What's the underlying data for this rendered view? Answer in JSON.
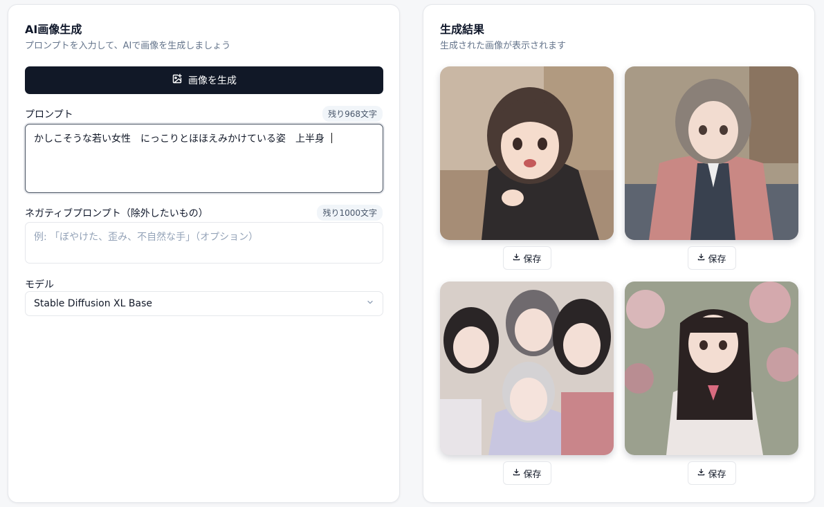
{
  "left_panel": {
    "title": "AI画像生成",
    "subtitle": "プロンプトを入力して、AIで画像を生成しましょう",
    "generate_button": {
      "label": "画像を生成",
      "icon": "image-plus-icon"
    },
    "prompt": {
      "label": "プロンプト",
      "counter": "残り968文字",
      "value": "かしこそうな若い女性　にっこりとほほえみかけている姿　上半身"
    },
    "negative_prompt": {
      "label": "ネガティブプロンプト（除外したいもの）",
      "counter": "残り1000文字",
      "placeholder": "例: 「ぼやけた、歪み、不自然な手」（オプション）"
    },
    "model": {
      "label": "モデル",
      "selected": "Stable Diffusion XL Base",
      "icon": "chevron-down-icon"
    }
  },
  "right_panel": {
    "title": "生成結果",
    "subtitle": "生成された画像が表示されます",
    "images": [
      {
        "save_label": "保存",
        "icon": "download-icon"
      },
      {
        "save_label": "保存",
        "icon": "download-icon"
      },
      {
        "save_label": "保存",
        "icon": "download-icon"
      },
      {
        "save_label": "保存",
        "icon": "download-icon"
      }
    ]
  },
  "colors": {
    "primary_button": "#111827",
    "muted_text": "#64748b",
    "border": "#e5e7eb"
  }
}
